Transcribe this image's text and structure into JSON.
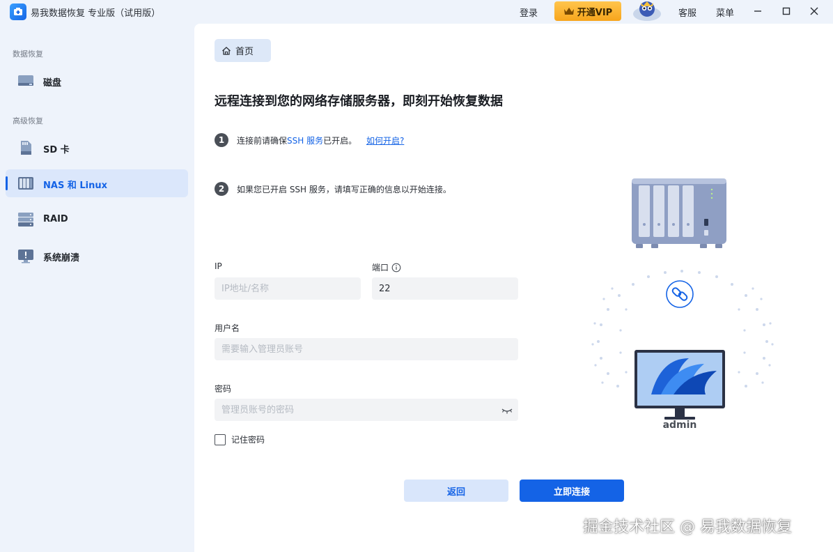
{
  "titlebar": {
    "app_title": "易我数据恢复 专业版（试用版）",
    "login": "登录",
    "vip": "开通VIP",
    "service": "客服",
    "menu": "菜单"
  },
  "sidebar": {
    "section_data": "数据恢复",
    "section_advanced": "高级恢复",
    "items": [
      {
        "label": "磁盘"
      },
      {
        "label": "SD 卡"
      },
      {
        "label": "NAS 和 Linux"
      },
      {
        "label": "RAID"
      },
      {
        "label": "系统崩溃"
      }
    ]
  },
  "main": {
    "home_tab": "首页",
    "heading": "远程连接到您的网络存储服务器，即刻开始恢复数据",
    "step1": {
      "num": "1",
      "prefix": "连接前请确保",
      "ssh": "SSH 服务",
      "suffix": "已开启。",
      "link": "如何开启?"
    },
    "step2": {
      "num": "2",
      "text": "如果您已开启 SSH 服务，请填写正确的信息以开始连接。"
    },
    "form": {
      "ip_label": "IP",
      "ip_placeholder": "IP地址/名称",
      "port_label": "端口",
      "port_value": "22",
      "user_label": "用户名",
      "user_placeholder": "需要输入管理员账号",
      "password_label": "密码",
      "password_placeholder": "管理员账号的密码",
      "remember": "记住密码"
    },
    "buttons": {
      "back": "返回",
      "connect": "立即连接"
    },
    "illustration": {
      "admin": "admin"
    }
  },
  "watermark": "掘金技术社区 @ 易我数据恢复",
  "colors": {
    "accent": "#1463e6",
    "vip": "#f7a51c",
    "sidebar_bg": "#eef3fb"
  }
}
